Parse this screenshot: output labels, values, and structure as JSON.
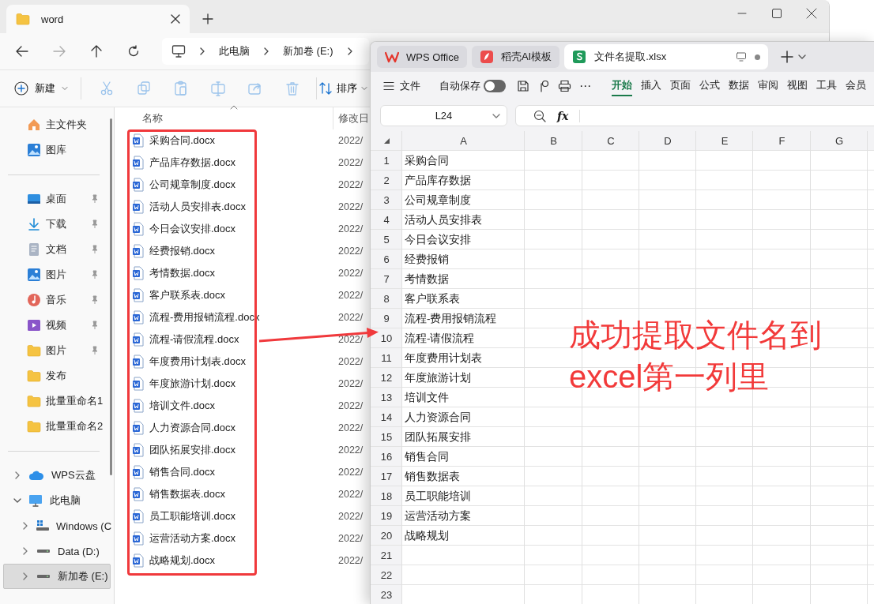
{
  "explorer": {
    "tab_title": "word",
    "breadcrumb": [
      "此电脑",
      "新加卷 (E:)"
    ],
    "toolbar": {
      "new_label": "新建",
      "actions": [
        {
          "kind": "cut",
          "disabled": true
        },
        {
          "kind": "copy",
          "disabled": true
        },
        {
          "kind": "paste",
          "disabled": true
        },
        {
          "kind": "rename",
          "disabled": true
        },
        {
          "kind": "share",
          "disabled": true
        },
        {
          "kind": "delete",
          "disabled": true
        }
      ],
      "sort_label": "排序"
    },
    "sidebar": {
      "top": [
        {
          "label": "主文件夹",
          "kind": "home"
        },
        {
          "label": "图库",
          "kind": "gallery"
        }
      ],
      "quick": [
        {
          "label": "桌面",
          "kind": "desktop",
          "pinned": true
        },
        {
          "label": "下载",
          "kind": "downloads",
          "pinned": true
        },
        {
          "label": "文档",
          "kind": "documents",
          "pinned": true
        },
        {
          "label": "图片",
          "kind": "pictures",
          "pinned": true
        },
        {
          "label": "音乐",
          "kind": "music",
          "pinned": true
        },
        {
          "label": "视频",
          "kind": "videos",
          "pinned": true
        },
        {
          "label": "图片",
          "kind": "folder",
          "pinned": true
        },
        {
          "label": "发布",
          "kind": "folder",
          "pinned": false
        },
        {
          "label": "批量重命名1",
          "kind": "folder",
          "pinned": false
        },
        {
          "label": "批量重命名2",
          "kind": "folder",
          "pinned": false
        }
      ],
      "tree": [
        {
          "label": "WPS云盘",
          "kind": "cloud",
          "expanded": false,
          "selected": false
        },
        {
          "label": "此电脑",
          "kind": "pc",
          "expanded": true,
          "selected": false,
          "children": [
            {
              "label": "Windows (C",
              "kind": "windows-drive",
              "expanded": false,
              "selected": false
            },
            {
              "label": "Data (D:)",
              "kind": "drive",
              "expanded": false,
              "selected": false
            },
            {
              "label": "新加卷 (E:)",
              "kind": "drive",
              "expanded": false,
              "selected": true
            }
          ]
        }
      ]
    },
    "columns": [
      "名称",
      "修改日"
    ],
    "files": [
      {
        "name": "采购合同.docx",
        "modified": "2022/"
      },
      {
        "name": "产品库存数据.docx",
        "modified": "2022/"
      },
      {
        "name": "公司规章制度.docx",
        "modified": "2022/"
      },
      {
        "name": "活动人员安排表.docx",
        "modified": "2022/"
      },
      {
        "name": "今日会议安排.docx",
        "modified": "2022/"
      },
      {
        "name": "经费报销.docx",
        "modified": "2022/"
      },
      {
        "name": "考情数据.docx",
        "modified": "2022/"
      },
      {
        "name": "客户联系表.docx",
        "modified": "2022/"
      },
      {
        "name": "流程-费用报销流程.docx",
        "modified": "2022/"
      },
      {
        "name": "流程-请假流程.docx",
        "modified": "2022/"
      },
      {
        "name": "年度费用计划表.docx",
        "modified": "2022/"
      },
      {
        "name": "年度旅游计划.docx",
        "modified": "2022/"
      },
      {
        "name": "培训文件.docx",
        "modified": "2022/"
      },
      {
        "name": "人力资源合同.docx",
        "modified": "2022/"
      },
      {
        "name": "团队拓展安排.docx",
        "modified": "2022/"
      },
      {
        "name": "销售合同.docx",
        "modified": "2022/"
      },
      {
        "name": "销售数据表.docx",
        "modified": "2022/"
      },
      {
        "name": "员工职能培训.docx",
        "modified": "2022/"
      },
      {
        "name": "运营活动方案.docx",
        "modified": "2022/"
      },
      {
        "name": "战略规划.docx",
        "modified": "2022/"
      }
    ]
  },
  "wps": {
    "tabs": [
      {
        "label": "WPS Office",
        "kind": "home",
        "selected": false
      },
      {
        "label": "稻壳AI模板",
        "kind": "template",
        "selected": false
      },
      {
        "label": "文件名提取.xlsx",
        "kind": "sheet",
        "selected": true
      }
    ],
    "file_menu": "文件",
    "autosave": {
      "label": "自动保存",
      "on": false
    },
    "more": "⋯",
    "ribbon": [
      {
        "label": "开始",
        "selected": true
      },
      {
        "label": "插入",
        "selected": false
      },
      {
        "label": "页面",
        "selected": false
      },
      {
        "label": "公式",
        "selected": false
      },
      {
        "label": "数据",
        "selected": false
      },
      {
        "label": "审阅",
        "selected": false
      },
      {
        "label": "视图",
        "selected": false
      },
      {
        "label": "工具",
        "selected": false
      },
      {
        "label": "会员",
        "selected": false
      }
    ],
    "name_box": "L24",
    "fx": "fx",
    "columns": [
      "A",
      "B",
      "C",
      "D",
      "E",
      "F",
      "G"
    ],
    "rows": [
      {
        "number": "1",
        "a": "采购合同"
      },
      {
        "number": "2",
        "a": "产品库存数据"
      },
      {
        "number": "3",
        "a": "公司规章制度"
      },
      {
        "number": "4",
        "a": "活动人员安排表"
      },
      {
        "number": "5",
        "a": "今日会议安排"
      },
      {
        "number": "6",
        "a": "经费报销"
      },
      {
        "number": "7",
        "a": "考情数据"
      },
      {
        "number": "8",
        "a": "客户联系表"
      },
      {
        "number": "9",
        "a": "流程-费用报销流程"
      },
      {
        "number": "10",
        "a": "流程-请假流程"
      },
      {
        "number": "11",
        "a": "年度费用计划表"
      },
      {
        "number": "12",
        "a": "年度旅游计划"
      },
      {
        "number": "13",
        "a": "培训文件"
      },
      {
        "number": "14",
        "a": "人力资源合同"
      },
      {
        "number": "15",
        "a": "团队拓展安排"
      },
      {
        "number": "16",
        "a": "销售合同"
      },
      {
        "number": "17",
        "a": "销售数据表"
      },
      {
        "number": "18",
        "a": "员工职能培训"
      },
      {
        "number": "19",
        "a": "运营活动方案"
      },
      {
        "number": "20",
        "a": "战略规划"
      },
      {
        "number": "21"
      },
      {
        "number": "22"
      },
      {
        "number": "23"
      }
    ]
  },
  "annotation": {
    "text": "成功提取文件名到excel第一列里"
  }
}
